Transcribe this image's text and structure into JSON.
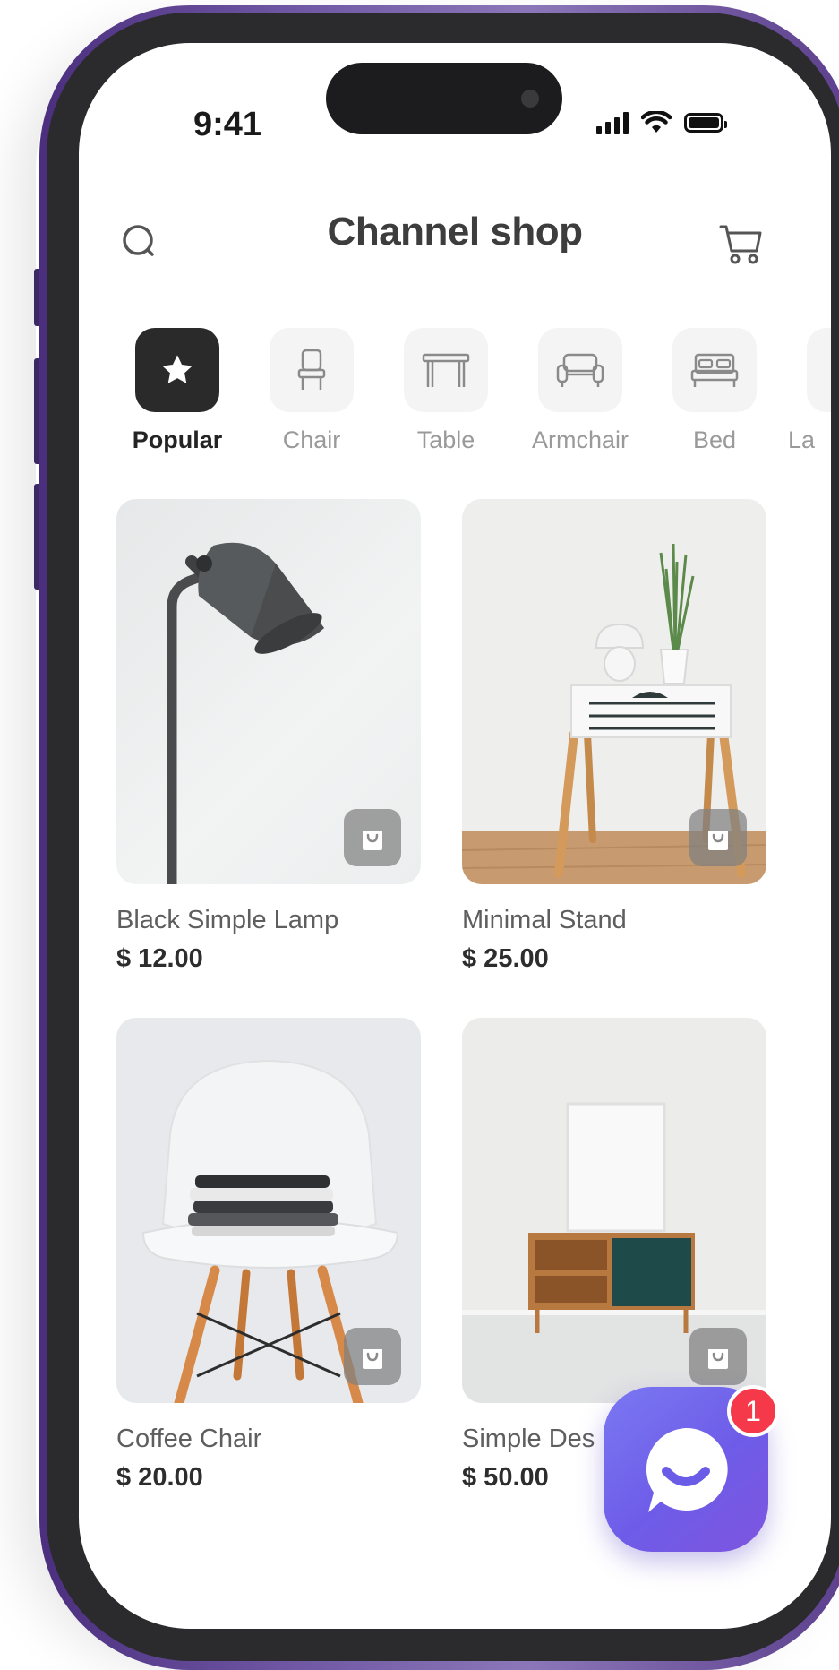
{
  "status_bar": {
    "time": "9:41"
  },
  "header": {
    "title": "Channel shop",
    "search_icon": "search-icon",
    "cart_icon": "cart-icon"
  },
  "categories": [
    {
      "label": "Popular",
      "icon": "star-icon",
      "active": true
    },
    {
      "label": "Chair",
      "icon": "chair-icon",
      "active": false
    },
    {
      "label": "Table",
      "icon": "table-icon",
      "active": false
    },
    {
      "label": "Armchair",
      "icon": "armchair-icon",
      "active": false
    },
    {
      "label": "Bed",
      "icon": "bed-icon",
      "active": false
    },
    {
      "label": "La",
      "icon": "lamp-icon",
      "active": false
    }
  ],
  "products": [
    {
      "name": "Black Simple Lamp",
      "price": "$ 12.00"
    },
    {
      "name": "Minimal Stand",
      "price": "$ 25.00"
    },
    {
      "name": "Coffee Chair",
      "price": "$ 20.00"
    },
    {
      "name": "Simple Des",
      "price": "$ 50.00"
    }
  ],
  "chat": {
    "badge_count": "1",
    "icon": "chat-smile-icon"
  },
  "colors": {
    "frame_purple": "#6e56a3",
    "bezel": "#2b2b2d",
    "active_category": "#2a2a2a",
    "chat_gradient_start": "#7a78f2",
    "chat_gradient_end": "#7e55df",
    "badge_red": "#f5394b"
  }
}
